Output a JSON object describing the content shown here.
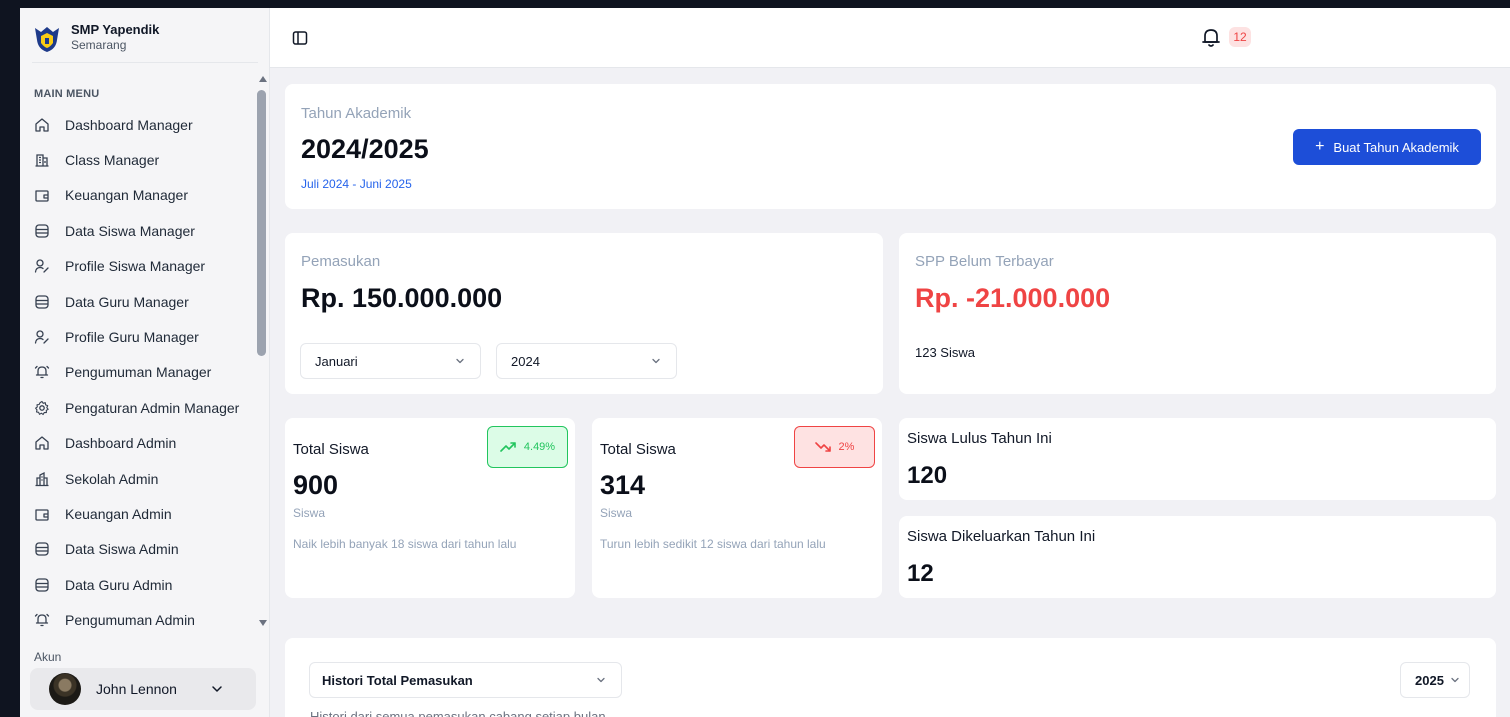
{
  "brand": {
    "name": "SMP Yapendik",
    "city": "Semarang"
  },
  "sidebar": {
    "section_title": "MAIN MENU",
    "items": [
      {
        "label": "Dashboard Manager",
        "icon": "home-icon"
      },
      {
        "label": "Class Manager",
        "icon": "building-icon"
      },
      {
        "label": "Keuangan Manager",
        "icon": "wallet-icon"
      },
      {
        "label": "Data Siswa Manager",
        "icon": "database-icon"
      },
      {
        "label": "Profile Siswa Manager",
        "icon": "user-edit-icon"
      },
      {
        "label": "Data Guru Manager",
        "icon": "database-icon"
      },
      {
        "label": "Profile Guru Manager",
        "icon": "user-edit-icon"
      },
      {
        "label": "Pengumuman Manager",
        "icon": "bell-ring-icon"
      },
      {
        "label": "Pengaturan Admin Manager",
        "icon": "gear-icon"
      },
      {
        "label": "Dashboard Admin",
        "icon": "home-icon"
      },
      {
        "label": "Sekolah Admin",
        "icon": "school-icon"
      },
      {
        "label": "Keuangan Admin",
        "icon": "wallet-icon"
      },
      {
        "label": "Data Siswa Admin",
        "icon": "database-icon"
      },
      {
        "label": "Data Guru Admin",
        "icon": "database-icon"
      },
      {
        "label": "Pengumuman Admin",
        "icon": "bell-ring-icon"
      }
    ],
    "account_label": "Akun",
    "user_name": "John Lennon"
  },
  "topbar": {
    "notification_count": "12"
  },
  "academic_year": {
    "label": "Tahun Akademik",
    "value": "2024/2025",
    "range": "Juli 2024 - Juni 2025",
    "create_button": "Buat Tahun Akademik"
  },
  "income": {
    "label": "Pemasukan",
    "value": "Rp. 150.000.000",
    "month_selected": "Januari",
    "year_selected": "2024"
  },
  "unpaid": {
    "label": "SPP Belum Terbayar",
    "value": "Rp. -21.000.000",
    "students": "123 Siswa"
  },
  "stats": [
    {
      "title": "Total Siswa",
      "value": "900",
      "unit": "Siswa",
      "trend": "4.49%",
      "direction": "up",
      "note": "Naik lebih banyak 18 siswa dari tahun lalu"
    },
    {
      "title": "Total Siswa",
      "value": "314",
      "unit": "Siswa",
      "trend": "2%",
      "direction": "down",
      "note": "Turun lebih sedikit 12 siswa dari tahun lalu"
    }
  ],
  "graduated": {
    "title": "Siswa Lulus Tahun Ini",
    "value": "120"
  },
  "expelled": {
    "title": "Siswa Dikeluarkan Tahun Ini",
    "value": "12"
  },
  "history": {
    "select_label": "Histori Total Pemasukan",
    "year_selected": "2025",
    "subtitle": "Histori dari semua pemasukan cabang setiap bulan"
  },
  "colors": {
    "primary": "#1d4ed8",
    "danger": "#ef4444",
    "success": "#22c55e",
    "muted": "#94a3b8",
    "link": "#2563eb"
  }
}
